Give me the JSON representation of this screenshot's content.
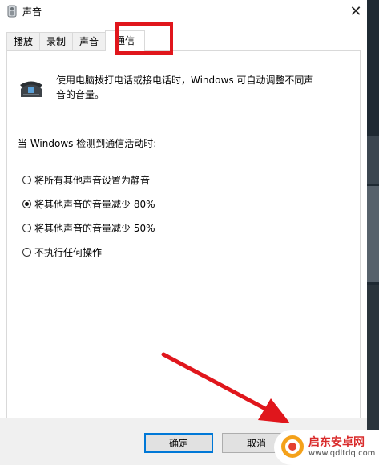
{
  "window": {
    "title": "声音"
  },
  "tabs": [
    {
      "label": "播放"
    },
    {
      "label": "录制"
    },
    {
      "label": "声音"
    },
    {
      "label": "通信"
    }
  ],
  "content": {
    "description": "使用电脑拨打电话或接电话时，Windows 可自动调整不同声音的音量。",
    "when_label": "当 Windows 检测到通信活动时:",
    "options": [
      {
        "label": "将所有其他声音设置为静音",
        "checked": false
      },
      {
        "label": "将其他声音的音量减少 80%",
        "checked": true
      },
      {
        "label": "将其他声音的音量减少 50%",
        "checked": false
      },
      {
        "label": "不执行任何操作",
        "checked": false
      }
    ]
  },
  "buttons": {
    "ok": "确定",
    "cancel": "取消"
  },
  "watermark": {
    "name": "启东安卓网",
    "url": "www.qdltdq.com"
  },
  "colors": {
    "highlight": "#e0161c",
    "focus": "#0078d7"
  }
}
